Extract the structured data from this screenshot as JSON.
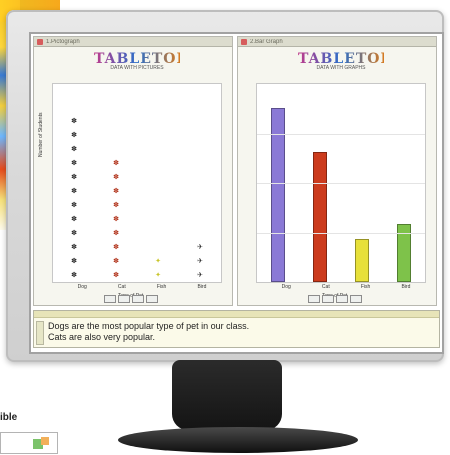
{
  "app": {
    "left_pane": {
      "logo_word": "TABLETOP",
      "tagline": "DATA WITH PICTURES",
      "titlebar_text": "1.Pictograph",
      "x_axis_label": "Type of Pet",
      "y_axis_label": "Number of Students",
      "categories": [
        "Dog",
        "Cat",
        "Fish",
        "Bird"
      ]
    },
    "right_pane": {
      "logo_word": "TABLETOP",
      "tagline": "DATA WITH GRAPHS",
      "titlebar_text": "2.Bar Graph",
      "x_axis_label": "Type of Pet",
      "categories": [
        "Dog",
        "Cat",
        "Fish",
        "Bird"
      ]
    },
    "notes": {
      "line1": "Dogs are the most popular type of pet in our class.",
      "line2": "Cats are also very popular."
    }
  },
  "caption": "ible",
  "chart_data": [
    {
      "type": "pictograph",
      "categories": [
        "Dog",
        "Cat",
        "Fish",
        "Bird"
      ],
      "values": [
        12,
        9,
        2,
        3
      ],
      "xlabel": "Type of Pet",
      "ylabel": "Number of Students"
    },
    {
      "type": "bar",
      "categories": [
        "Dog",
        "Cat",
        "Fish",
        "Bird"
      ],
      "values": [
        12,
        9,
        3,
        4
      ],
      "colors": [
        "#8a79d6",
        "#cc3b1d",
        "#e7e03a",
        "#7ec24a"
      ],
      "xlabel": "Type of Pet",
      "ylim": [
        0,
        13
      ]
    }
  ]
}
